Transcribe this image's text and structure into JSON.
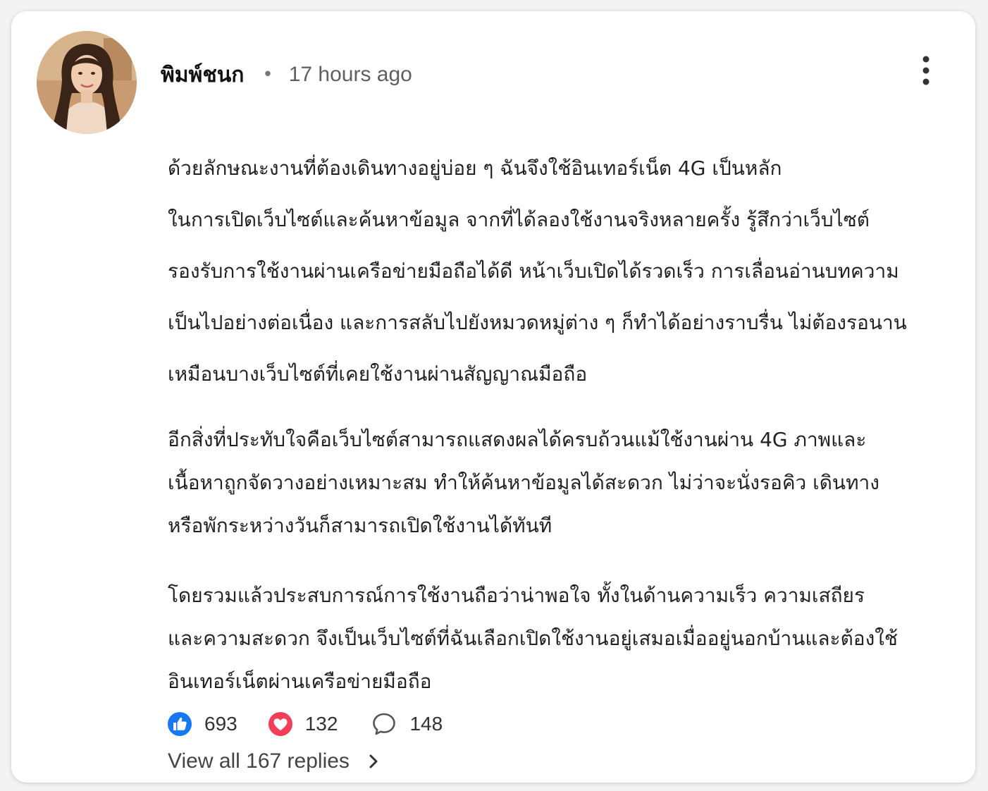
{
  "comment": {
    "author": "พิมพ์ชนก",
    "separator": "•",
    "time": "17 hours ago",
    "paragraphs": [
      [
        "ด้วยลักษณะงานที่ต้องเดินทางอยู่บ่อย ๆ ฉันจึงใช้อินเทอร์เน็ต 4G เป็นหลัก",
        "ในการเปิดเว็บไซต์และค้นหาข้อมูล จากที่ได้ลองใช้งานจริงหลายครั้ง รู้สึกว่าเว็บไซต์",
        "รองรับการใช้งานผ่านเครือข่ายมือถือได้ดี หน้าเว็บเปิดได้รวดเร็ว การเลื่อนอ่านบทความ",
        "เป็นไปอย่างต่อเนื่อง และการสลับไปยังหมวดหมู่ต่าง ๆ ก็ทำได้อย่างราบรื่น ไม่ต้องรอนาน",
        "เหมือนบางเว็บไซต์ที่เคยใช้งานผ่านสัญญาณมือถือ"
      ],
      [
        "อีกสิ่งที่ประทับใจคือเว็บไซต์สามารถแสดงผลได้ครบถ้วนแม้ใช้งานผ่าน 4G ภาพและ",
        "เนื้อหาถูกจัดวางอย่างเหมาะสม ทำให้ค้นหาข้อมูลได้สะดวก ไม่ว่าจะนั่งรอคิว เดินทาง",
        "หรือพักระหว่างวันก็สามารถเปิดใช้งานได้ทันที"
      ],
      [
        "โดยรวมแล้วประสบการณ์การใช้งานถือว่าน่าพอใจ ทั้งในด้านความเร็ว ความเสถียร",
        "และความสะดวก จึงเป็นเว็บไซต์ที่ฉันเลือกเปิดใช้งานอยู่เสมอเมื่ออยู่นอกบ้านและต้องใช้",
        "อินเทอร์เน็ตผ่านเครือข่ายมือถือ"
      ]
    ]
  },
  "reactions": {
    "likes": "693",
    "hearts": "132",
    "comments": "148"
  },
  "replies": {
    "label": "View all 167 replies"
  },
  "icons": {
    "like": "thumbs-up-icon",
    "heart": "heart-icon",
    "comment": "comment-bubble-icon",
    "more": "more-vertical-icon",
    "chevron": "chevron-right-icon"
  },
  "colors": {
    "like": "#1877f2",
    "heart": "#f33e58",
    "text": "#222222",
    "meta": "#606060"
  }
}
